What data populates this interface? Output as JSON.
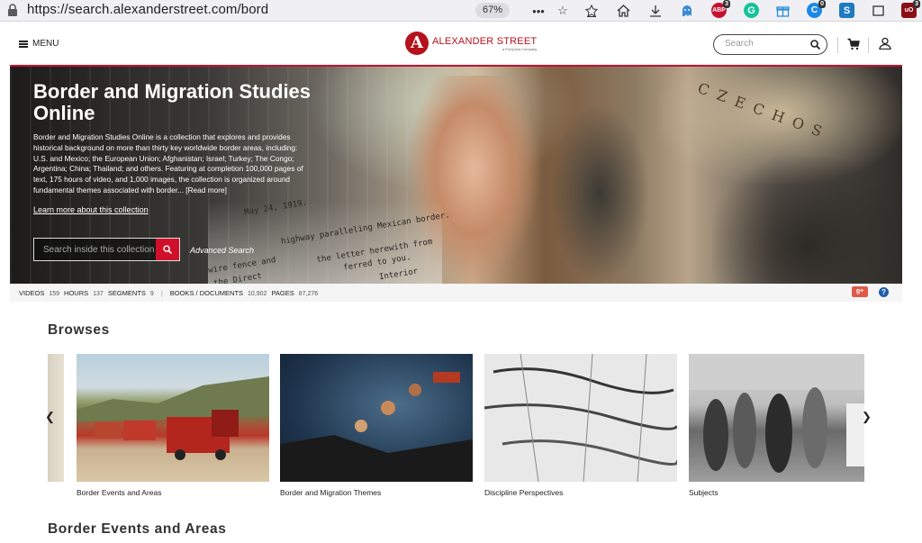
{
  "browser": {
    "url": "https://search.alexanderstreet.com/bord",
    "zoom": "67%",
    "extension_badges": {
      "abp": "ABP",
      "abp_count": "3",
      "pocket_count": "0",
      "ublock_count": "3"
    }
  },
  "header": {
    "menu_label": "MENU",
    "logo_name": "ALEXANDER STREET",
    "logo_tagline": "a ProQuest Company",
    "search_placeholder": "Search"
  },
  "hero": {
    "title": "Border and Migration Studies Online",
    "description": "Border and Migration Studies Online is a collection that explores and provides historical background on more than thirty key worldwide border areas, including: U.S. and Mexico; the European Union; Afghanistan; Israel; Turkey; The Congo; Argentina; China; Thailand; and others. Featuring at completion 100,000 pages of text, 175 hours of video, and 1,000 images, the collection is organized around fundamental themes associated with border... [Read more]",
    "learn_more": "Learn more about this collection",
    "search_placeholder": "Search inside this collection",
    "advanced_search": "Advanced Search",
    "map_text": "CZECHOS",
    "doc_lines": [
      "May 24, 1919.",
      "highway paralleling Mexican border.",
      "the letter herewith from",
      "ferred to you.",
      "Interior",
      "wire fence and",
      "the Direct"
    ]
  },
  "stats": {
    "videos_label": "VIDEOS",
    "videos": "159",
    "hours_label": "HOURS",
    "hours": "137",
    "segments_label": "SEGMENTS",
    "segments": "9",
    "books_label": "BOOKS / DOCUMENTS",
    "books": "10,902",
    "pages_label": "PAGES",
    "pages": "87,276"
  },
  "browses": {
    "title": "Browses",
    "items": [
      {
        "label": "Border Events and Areas"
      },
      {
        "label": "Border and Migration Themes"
      },
      {
        "label": "Discipline Perspectives"
      },
      {
        "label": "Subjects"
      }
    ]
  },
  "next_section": {
    "title": "Border Events and Areas"
  }
}
